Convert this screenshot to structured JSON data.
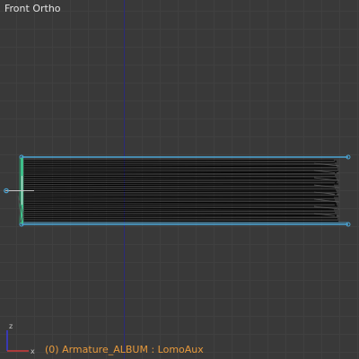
{
  "viewport": {
    "view_label": "Front Ortho",
    "object_info": "(0) Armature_ALBUM : LomoAux",
    "gizmo_labels": {
      "x": "x",
      "z": "z"
    }
  },
  "colors": {
    "background": "#393939",
    "grid_minor": "#404040",
    "grid_major": "#484848",
    "z_axis": "#2a2a7a",
    "x_axis": "#7a2a2a",
    "selection": "#4aa6d6",
    "bone_active": "#3dbf8a",
    "mesh_wire": "#000000",
    "label_text": "#e6e6e6",
    "info_text": "#e89a3c",
    "gizmo_x": "#d23a3a",
    "gizmo_z": "#3a3ad2"
  }
}
